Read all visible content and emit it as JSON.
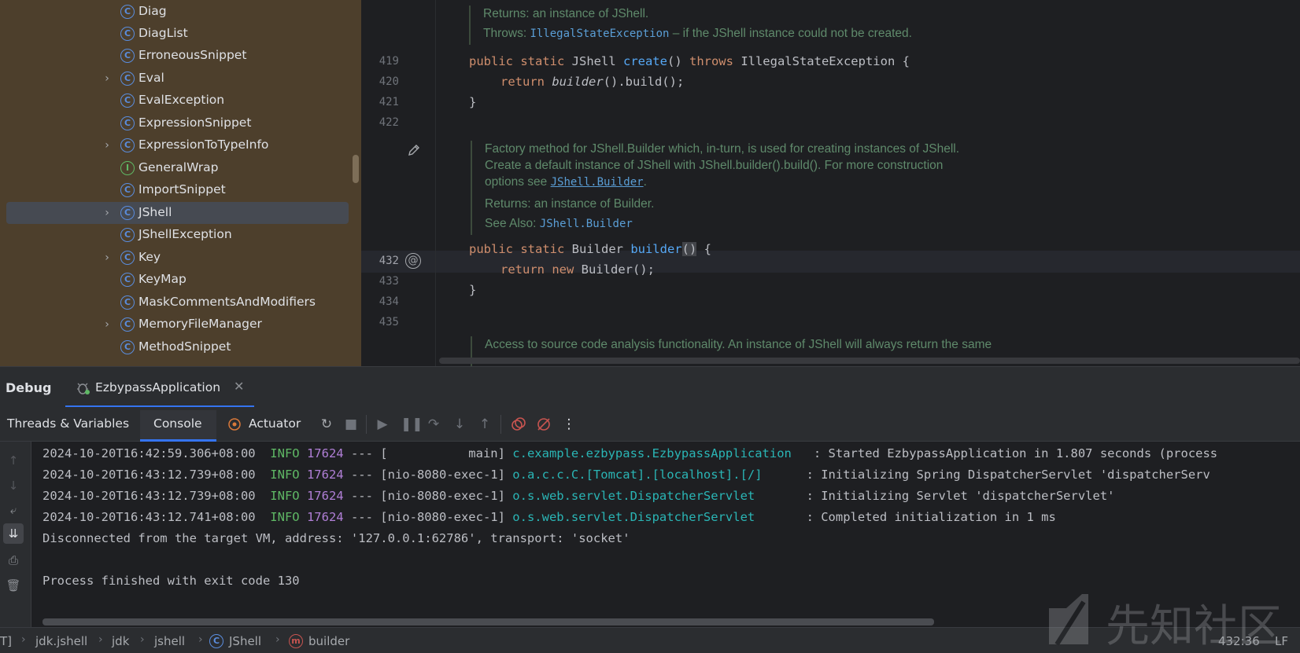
{
  "tree": {
    "items": [
      {
        "label": "Diag",
        "expandable": false,
        "kind": "C"
      },
      {
        "label": "DiagList",
        "expandable": false,
        "kind": "C"
      },
      {
        "label": "ErroneousSnippet",
        "expandable": false,
        "kind": "C"
      },
      {
        "label": "Eval",
        "expandable": true,
        "kind": "C"
      },
      {
        "label": "EvalException",
        "expandable": false,
        "kind": "C"
      },
      {
        "label": "ExpressionSnippet",
        "expandable": false,
        "kind": "C"
      },
      {
        "label": "ExpressionToTypeInfo",
        "expandable": true,
        "kind": "C"
      },
      {
        "label": "GeneralWrap",
        "expandable": false,
        "kind": "I"
      },
      {
        "label": "ImportSnippet",
        "expandable": false,
        "kind": "C"
      },
      {
        "label": "JShell",
        "expandable": true,
        "kind": "C",
        "selected": true
      },
      {
        "label": "JShellException",
        "expandable": false,
        "kind": "C"
      },
      {
        "label": "Key",
        "expandable": true,
        "kind": "C"
      },
      {
        "label": "KeyMap",
        "expandable": false,
        "kind": "C"
      },
      {
        "label": "MaskCommentsAndModifiers",
        "expandable": false,
        "kind": "C"
      },
      {
        "label": "MemoryFileManager",
        "expandable": true,
        "kind": "C"
      },
      {
        "label": "MethodSnippet",
        "expandable": false,
        "kind": "C"
      }
    ]
  },
  "editor": {
    "doc1": {
      "returns": "Returns: an instance of JShell.",
      "throws_label": "Throws:",
      "throws_link": "IllegalStateException",
      "throws_text": " – if the JShell instance could not be created."
    },
    "lines": {
      "n419": "419",
      "n420": "420",
      "n421": "421",
      "n422": "422",
      "n432": "432",
      "n433": "433",
      "n434": "434",
      "n435": "435"
    },
    "code": {
      "l419_kw": "public static ",
      "l419_type": "JShell ",
      "l419_fn": "create",
      "l419_rest1": "() ",
      "l419_throws": "throws ",
      "l419_rest2": "IllegalStateException {",
      "l420_kw": "return ",
      "l420_call": "builder",
      "l420_rest": "().build();",
      "l421": "}",
      "l432_kw": "public static ",
      "l432_type": "Builder ",
      "l432_fn": "builder",
      "l432_paren": "()",
      "l432_rest": " {",
      "l433_kw": "return new ",
      "l433_rest": "Builder();",
      "l434": "}"
    },
    "doc2": {
      "line1": "Factory method for JShell.Builder which, in-turn, is used for creating instances of JShell.",
      "line2": "Create a default instance of JShell with JShell.builder().build(). For more construction",
      "line3_pre": "options see ",
      "line3_link": "JShell.Builder",
      "line3_post": ".",
      "returns": "Returns:   an instance of Builder.",
      "see_label": "See Also: ",
      "see_link": "JShell.Builder"
    },
    "doc3": {
      "line1": "Access to source code analysis functionality. An instance of JShell will always return the same"
    }
  },
  "debug": {
    "title": "Debug",
    "run_config": "EzbypassApplication",
    "tabs": {
      "threads": "Threads & Variables",
      "console": "Console",
      "actuator": "Actuator"
    }
  },
  "console": {
    "lines": [
      {
        "ts": "2024-10-20T16:42:59.306+08:00",
        "level": "INFO",
        "pid": "17624",
        "thread": " --- [           main] ",
        "logger": "c.example.ezbypass.EzbypassApplication  ",
        "msg": " : Started EzbypassApplication in 1.807 seconds (process"
      },
      {
        "ts": "2024-10-20T16:43:12.739+08:00",
        "level": "INFO",
        "pid": "17624",
        "thread": " --- [nio-8080-exec-1] ",
        "logger": "o.a.c.c.C.[Tomcat].[localhost].[/]     ",
        "msg": " : Initializing Spring DispatcherServlet 'dispatcherServ"
      },
      {
        "ts": "2024-10-20T16:43:12.739+08:00",
        "level": "INFO",
        "pid": "17624",
        "thread": " --- [nio-8080-exec-1] ",
        "logger": "o.s.web.servlet.DispatcherServlet      ",
        "msg": " : Initializing Servlet 'dispatcherServlet'"
      },
      {
        "ts": "2024-10-20T16:43:12.741+08:00",
        "level": "INFO",
        "pid": "17624",
        "thread": " --- [nio-8080-exec-1] ",
        "logger": "o.s.web.servlet.DispatcherServlet      ",
        "msg": " : Completed initialization in 1 ms"
      }
    ],
    "disconnected": "Disconnected from the target VM, address: '127.0.0.1:62786', transport: 'socket'",
    "finished": "Process finished with exit code 130"
  },
  "statusbar": {
    "crumbs": [
      "T]",
      "jdk.jshell",
      "jdk",
      "jshell",
      "JShell",
      "builder"
    ],
    "caret": "432:36",
    "line_sep": "LF"
  },
  "watermark": {
    "text": "先知社区"
  }
}
